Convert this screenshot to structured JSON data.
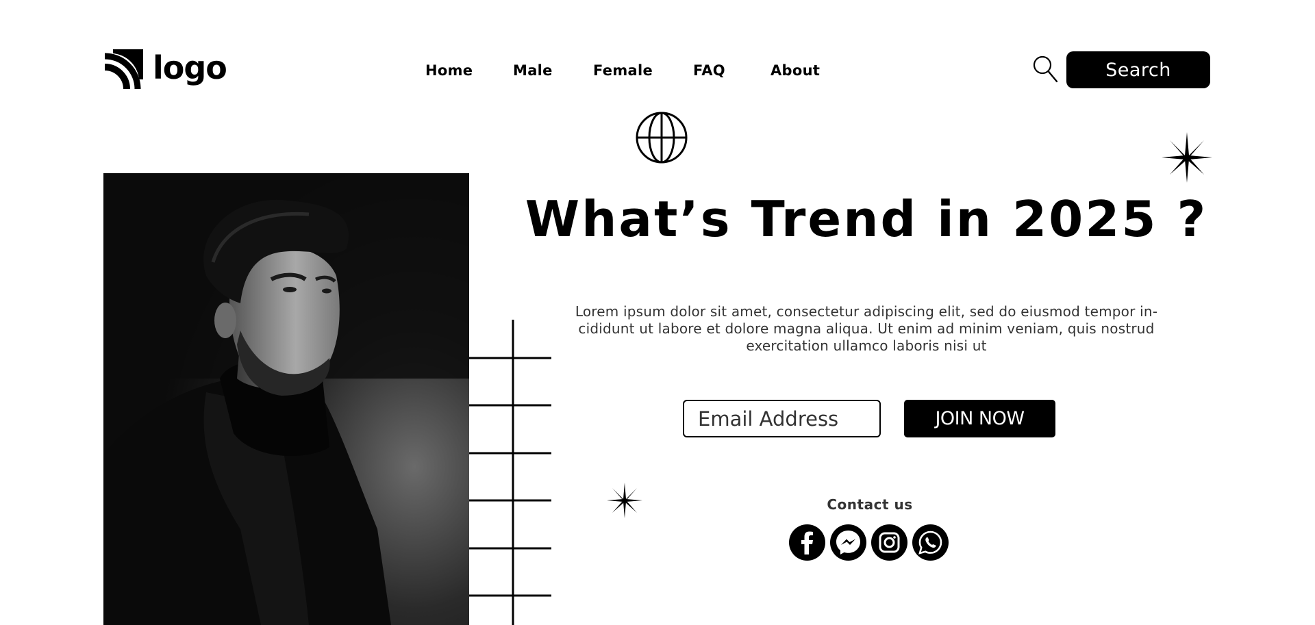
{
  "header": {
    "logo_text": "logo",
    "nav": [
      {
        "label": "Home"
      },
      {
        "label": "Male"
      },
      {
        "label": "Female"
      },
      {
        "label": "FAQ"
      },
      {
        "label": "About"
      }
    ],
    "search_label": "Search"
  },
  "hero": {
    "title": "What’s Trend in 2025 ?",
    "description": "Lorem ipsum dolor sit amet, consectetur adipiscing elit, sed do eiusmod tempor in-cididunt ut labore et dolore magna aliqua. Ut enim ad minim veniam, quis nostrud exercitation ullamco laboris nisi ut",
    "email_placeholder": "Email Address",
    "join_label": "JOIN NOW",
    "contact_label": "Contact us"
  },
  "social": [
    {
      "icon": "facebook-icon"
    },
    {
      "icon": "messenger-icon"
    },
    {
      "icon": "instagram-icon"
    },
    {
      "icon": "whatsapp-icon"
    }
  ],
  "theme": {
    "primary": "#000000",
    "background": "#ffffff",
    "text_muted": "#333333"
  }
}
